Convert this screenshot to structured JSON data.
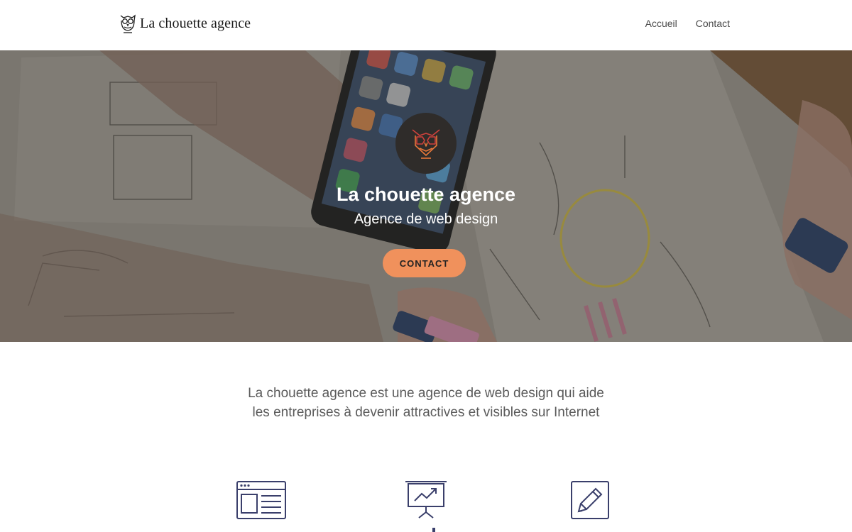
{
  "header": {
    "brand_name": "La chouette agence",
    "logo_icon": "owl-line-icon",
    "nav": [
      {
        "label": "Accueil"
      },
      {
        "label": "Contact"
      }
    ]
  },
  "hero": {
    "background": "photo-hands-sketching-wireframes-with-phone",
    "badge_icon": "owl-geometric-icon",
    "title": "La chouette agence",
    "subtitle": "Agence de web design",
    "cta_label": "CONTACT"
  },
  "intro": {
    "line1": "La chouette agence est une agence de web design qui aide",
    "line2": "les entreprises à devenir attractives et visibles sur Internet"
  },
  "features": [
    {
      "icon": "web-layout-icon"
    },
    {
      "icon": "presentation-chart-icon"
    },
    {
      "icon": "pencil-edit-icon"
    }
  ],
  "colors": {
    "accent": "#f0915c",
    "icon_stroke": "#3a3f6b",
    "badge_bg": "#2f2c2a",
    "owl_orange": "#e8783a",
    "owl_red": "#d0423c"
  }
}
